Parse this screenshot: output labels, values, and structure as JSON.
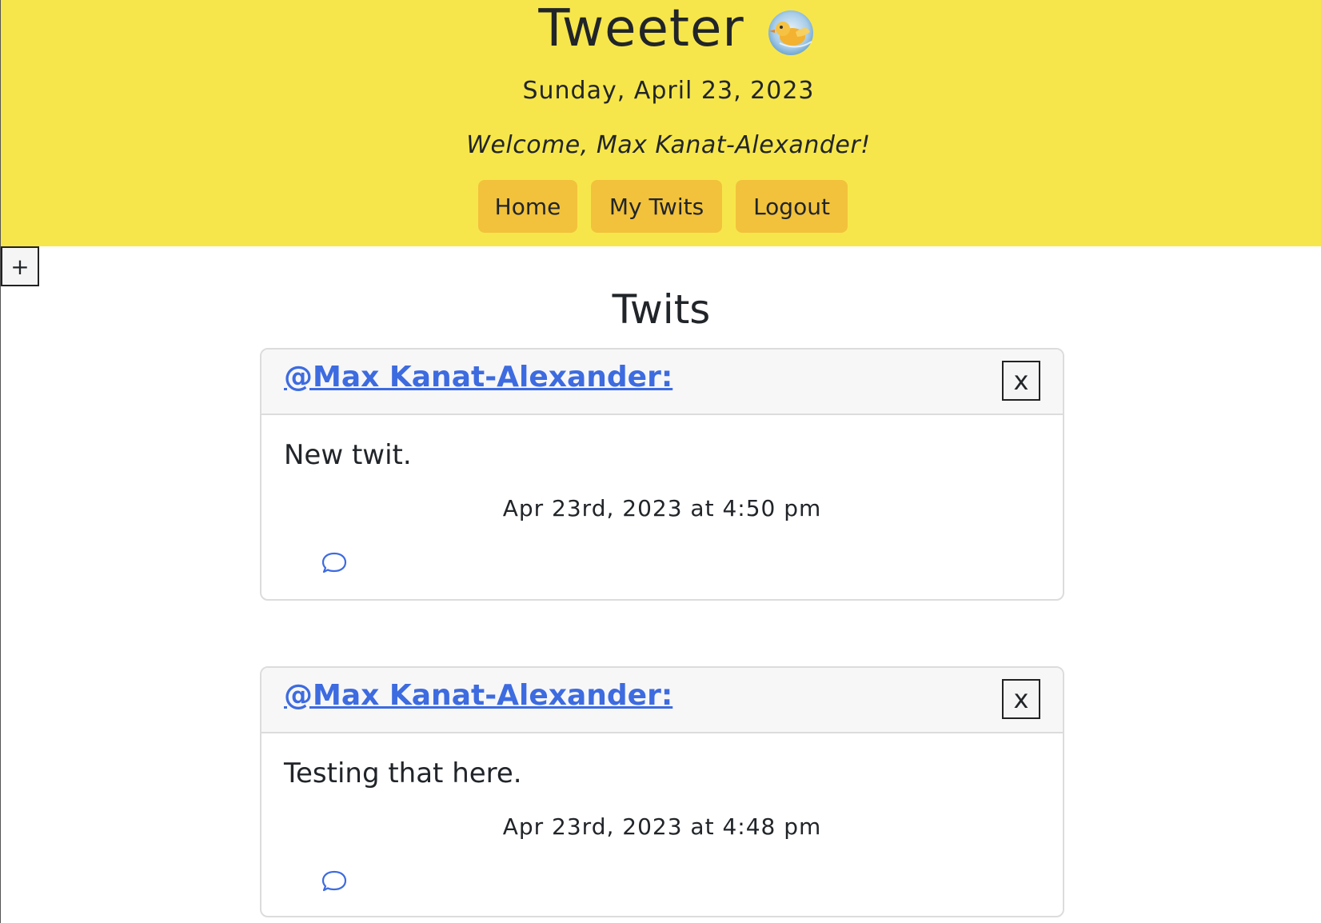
{
  "header": {
    "title": "Tweeter",
    "logo_icon": "bird-logo-icon",
    "date": "Sunday, April 23, 2023",
    "welcome": "Welcome, Max Kanat-Alexander!",
    "nav": [
      {
        "label": "Home"
      },
      {
        "label": "My Twits"
      },
      {
        "label": "Logout"
      }
    ]
  },
  "add_button_label": "+",
  "section_title": "Twits",
  "twits": [
    {
      "author": "@Max Kanat-Alexander:",
      "close_label": "x",
      "text": "New twit.",
      "timestamp": "Apr 23rd, 2023 at 4:50 pm",
      "comment_icon": "comment-bubble-icon"
    },
    {
      "author": "@Max Kanat-Alexander:",
      "close_label": "x",
      "text": "Testing that here.",
      "timestamp": "Apr 23rd, 2023 at 4:48 pm",
      "comment_icon": "comment-bubble-icon"
    }
  ],
  "colors": {
    "header_bg": "#f7e64b",
    "nav_button_bg": "#f2c23c",
    "link": "#3d6be0"
  }
}
